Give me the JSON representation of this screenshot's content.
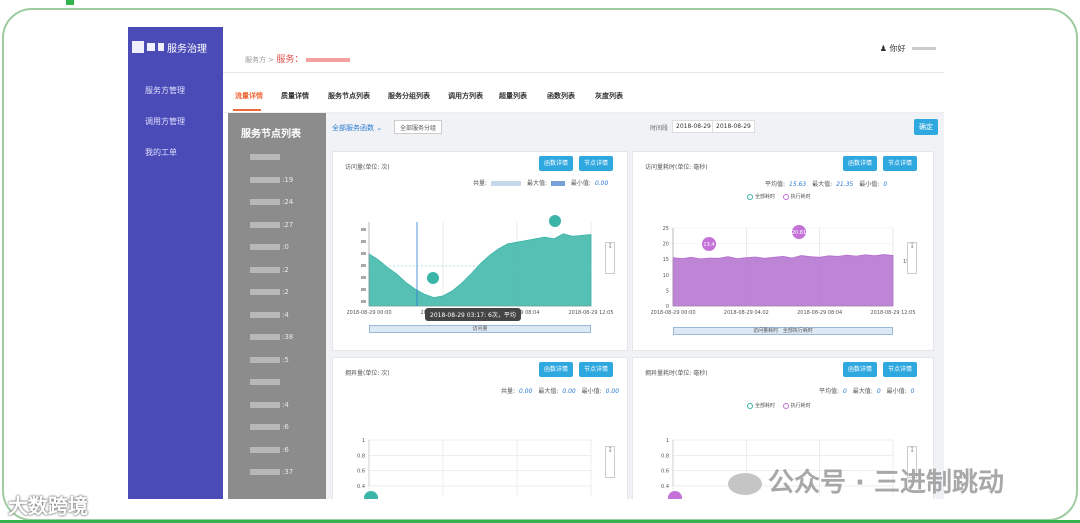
{
  "app": {
    "logo_text": "服务治理",
    "user_name": "你好"
  },
  "sidebar": {
    "items": [
      "服务方管理",
      "调用方管理",
      "我的工单"
    ]
  },
  "breadcrumb": {
    "parent": "服务方 >",
    "service_label": "服务："
  },
  "tabs": [
    "流量详情",
    "质量详情",
    "服务节点列表",
    "服务分组列表",
    "调用方列表",
    "超量列表",
    "函数列表",
    "灰度列表"
  ],
  "nodes": {
    "title": "服务节点列表",
    "items": [
      "",
      ":19",
      ":24",
      ":27",
      ":0",
      ":2",
      ":2",
      ":4",
      ":38",
      ":5",
      "",
      ":4",
      ":6",
      ":6",
      ":37"
    ]
  },
  "filters": {
    "service_selector": "全部服务函数",
    "group_selector": "全部服务分组",
    "time_label": "时间段",
    "start_date": "2018-08-29",
    "end_date": "2018-08-29",
    "query_button": "确定"
  },
  "panels": {
    "tl": {
      "title": "访问量(单位: 次)",
      "btn1": "函数详情",
      "btn2": "节点详情",
      "total_label": "共量:",
      "max_label": "最大值:",
      "min_label": "最小值:",
      "min_value": "0.00",
      "slider_label": "访问量",
      "tooltip": "2018-08-29 03:17:",
      "tooltip2": "6次，平均"
    },
    "tr": {
      "title": "访问量耗时(单位: 毫秒)",
      "btn1": "函数详情",
      "btn2": "节点详情",
      "avg_label": "平均值:",
      "avg_value": "15.63",
      "max_label": "最大值:",
      "max_value": "21.35",
      "min_label": "最小值:",
      "min_value": "0",
      "legend1": "全部耗时",
      "legend2": "执行耗时",
      "pin1": "13.4",
      "pin2": "20.81",
      "side_label": "15.88",
      "slider_label1": "访问量耗时",
      "slider_label2": "全部执行耗时"
    },
    "bl": {
      "title": "拥异量(单位: 次)",
      "btn1": "函数详情",
      "btn2": "节点详情",
      "total_label": "共量:",
      "total_value": "0.00",
      "max_label": "最大值:",
      "max_value": "0.00",
      "min_label": "最小值:",
      "min_value": "0.00"
    },
    "br": {
      "title": "拥异量耗时(单位: 毫秒)",
      "btn1": "函数详情",
      "btn2": "节点详情",
      "avg_label": "平均值:",
      "avg_value": "0",
      "max_label": "最大值:",
      "max_value": "0",
      "min_label": "最小值:",
      "min_value": "0",
      "legend1": "全部耗时",
      "legend2": "执行耗时"
    }
  },
  "watermark": {
    "text": "公众号 · 三进制跳动",
    "text2": "大数跨境"
  },
  "colors": {
    "sidebar": "#4a4bb7",
    "accent": "#2fa8e0",
    "teal": "#3ab5a7",
    "purple": "#b36fcf",
    "tab_active": "#ef6a3a"
  },
  "chart_data": [
    {
      "type": "area",
      "title": "访问量(单位: 次)",
      "x_tick_labels": [
        "2018-08-29 00:00",
        "2018-08-29 04:02",
        "2018-08-29 08:04",
        "2018-08-29 12:05"
      ],
      "values": [
        0.62,
        0.55,
        0.46,
        0.38,
        0.28,
        0.2,
        0.14,
        0.1,
        0.12,
        0.18,
        0.27,
        0.38,
        0.5,
        0.6,
        0.68,
        0.74,
        0.76,
        0.78,
        0.8,
        0.82,
        0.8,
        0.86,
        0.83,
        0.84,
        0.85
      ],
      "color": "#3ab5a7"
    },
    {
      "type": "area",
      "title": "访问量耗时(单位: 毫秒)",
      "x_tick_labels": [
        "2018-08-29 00:00",
        "2018-08-29 04:02",
        "2018-08-29 08:04",
        "2018-08-29 12:05"
      ],
      "y_tick_labels": [
        "0",
        "5",
        "10",
        "15",
        "20",
        "25"
      ],
      "ylim": [
        0,
        25
      ],
      "values": [
        15.5,
        15.2,
        15.6,
        15.1,
        15.4,
        15.3,
        15.8,
        15.2,
        15.5,
        15.7,
        15.3,
        15.6,
        15.9,
        15.4,
        16.2,
        15.8,
        15.6,
        16.1,
        15.9,
        16.3,
        16.0,
        16.4,
        16.1,
        16.5,
        16.2
      ],
      "color": "#b36fcf"
    },
    {
      "type": "line",
      "title": "拥异量(单位: 次)",
      "y_tick_labels": [
        "0.4",
        "0.6",
        "0.8",
        "1"
      ],
      "values": []
    },
    {
      "type": "line",
      "title": "拥异量耗时(单位: 毫秒)",
      "y_tick_labels": [
        "0.4",
        "0.6",
        "0.8",
        "1"
      ],
      "values": []
    }
  ]
}
